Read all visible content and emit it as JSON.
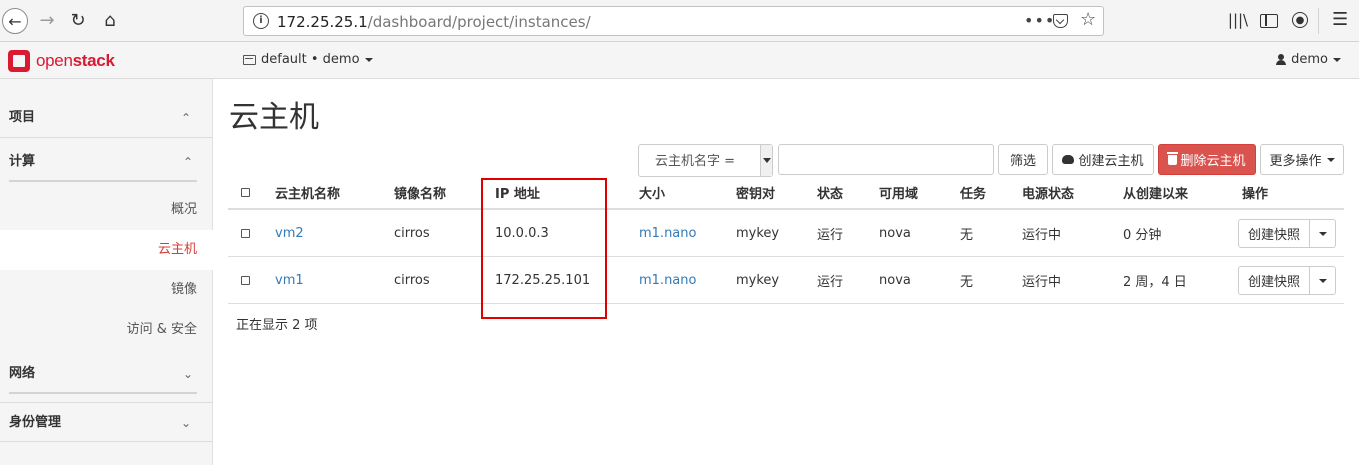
{
  "browser": {
    "url_host": "172.25.25.1",
    "url_path": "/dashboard/project/instances/",
    "more_glyph": "•••"
  },
  "header": {
    "brand_prefix": "open",
    "brand_suffix": "stack",
    "project": "default • demo",
    "user": "demo"
  },
  "sidebar": {
    "project": "项目",
    "compute": "计算",
    "items": [
      {
        "label": "概况"
      },
      {
        "label": "云主机"
      },
      {
        "label": "镜像"
      },
      {
        "label": "访问 & 安全"
      }
    ],
    "network": "网络",
    "identity": "身份管理"
  },
  "page": {
    "title": "云主机",
    "filter_select": "云主机名字 =",
    "filter_button": "筛选",
    "create_button": "创建云主机",
    "delete_button": "删除云主机",
    "more_button": "更多操作",
    "footer": "正在显示 2 项"
  },
  "table": {
    "headers": [
      "云主机名称",
      "镜像名称",
      "IP 地址",
      "大小",
      "密钥对",
      "状态",
      "可用域",
      "任务",
      "电源状态",
      "从创建以来",
      "操作"
    ],
    "rows": [
      {
        "name": "vm2",
        "image": "cirros",
        "ip": "10.0.0.3",
        "size": "m1.nano",
        "key": "mykey",
        "status": "运行",
        "az": "nova",
        "task": "无",
        "power": "运行中",
        "age": "0 分钟",
        "action": "创建快照"
      },
      {
        "name": "vm1",
        "image": "cirros",
        "ip": "172.25.25.101",
        "size": "m1.nano",
        "key": "mykey",
        "status": "运行",
        "az": "nova",
        "task": "无",
        "power": "运行中",
        "age": "2 周，4 日",
        "action": "创建快照"
      }
    ]
  },
  "colors": {
    "brand": "#da1a32",
    "danger": "#d9534f",
    "link": "#337ab7",
    "highlight": "#e00000"
  }
}
